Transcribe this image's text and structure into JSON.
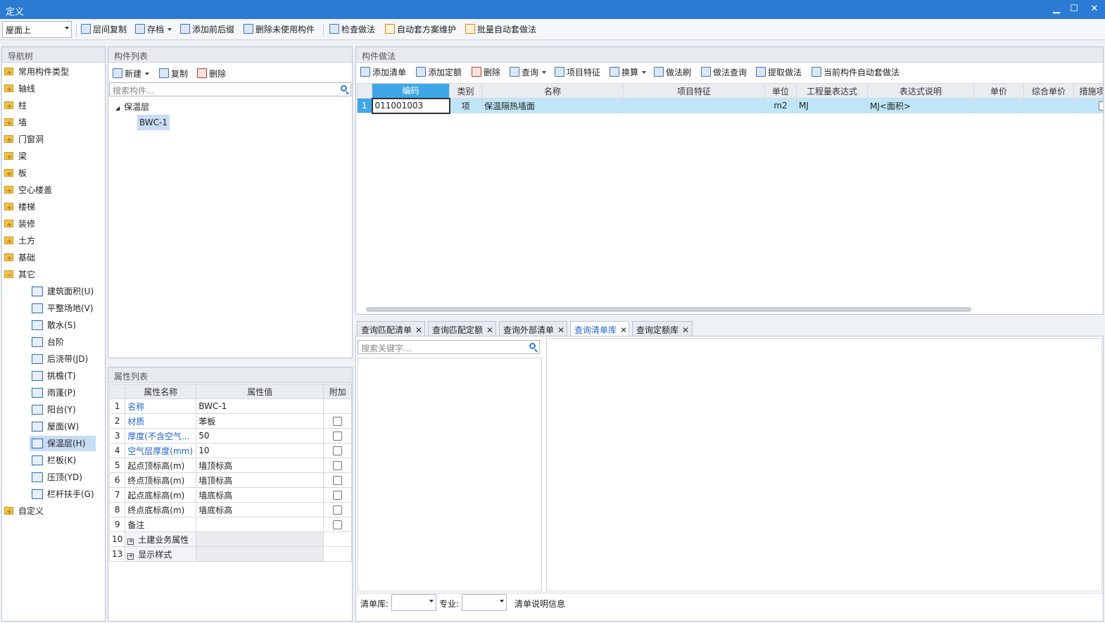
{
  "window": {
    "title": "定义",
    "min": "▁",
    "max": "☐",
    "close": "✕"
  },
  "toolbar": {
    "floor_value": "屋面上",
    "buttons": [
      "层间复制",
      "存档",
      "添加前后缀",
      "删除未使用构件",
      "检查做法",
      "自动套方案维护",
      "批量自动套做法"
    ]
  },
  "nav": {
    "title": "导航树",
    "top_items": [
      "常用构件类型",
      "轴线",
      "柱",
      "墙",
      "门窗洞",
      "梁",
      "板",
      "空心楼盖",
      "楼梯",
      "装修",
      "土方",
      "基础",
      "其它"
    ],
    "children": [
      "建筑面积(U)",
      "平整场地(V)",
      "散水(S)",
      "台阶",
      "后浇带(JD)",
      "挑檐(T)",
      "雨蓬(P)",
      "阳台(Y)",
      "屋面(W)",
      "保温层(H)",
      "栏板(K)",
      "压顶(YD)",
      "栏杆扶手(G)"
    ],
    "last_item": "自定义"
  },
  "component_list": {
    "title": "构件列表",
    "new_label": "新建",
    "copy_label": "复制",
    "delete_label": "删除",
    "search_placeholder": "搜索构件...",
    "group": "保温层",
    "selected_item": "BWC-1"
  },
  "properties": {
    "title": "属性列表",
    "headers": [
      "属性名称",
      "属性值",
      "附加"
    ],
    "rows": [
      {
        "n": "1",
        "name": "名称",
        "value": "BWC-1"
      },
      {
        "n": "2",
        "name": "材质",
        "value": "苯板"
      },
      {
        "n": "3",
        "name": "厚度(不含空气...",
        "value": "50"
      },
      {
        "n": "4",
        "name": "空气层厚度(mm)",
        "value": "10"
      },
      {
        "n": "5",
        "name": "起点顶标高(m)",
        "value": "墙顶标高"
      },
      {
        "n": "6",
        "name": "终点顶标高(m)",
        "value": "墙顶标高"
      },
      {
        "n": "7",
        "name": "起点底标高(m)",
        "value": "墙底标高"
      },
      {
        "n": "8",
        "name": "终点底标高(m)",
        "value": "墙底标高"
      },
      {
        "n": "9",
        "name": "备注",
        "value": ""
      }
    ],
    "groups": [
      {
        "n": "10",
        "name": "土建业务属性"
      },
      {
        "n": "13",
        "name": "显示样式"
      }
    ]
  },
  "method": {
    "title": "构件做法",
    "toolbar": [
      "添加清单",
      "添加定额",
      "删除",
      "查询",
      "项目特征",
      "换算",
      "做法刷",
      "做法查询",
      "提取做法",
      "当前构件自动套做法"
    ],
    "headers": [
      "编码",
      "类别",
      "名称",
      "项目特征",
      "单位",
      "工程量表达式",
      "表达式说明",
      "单价",
      "综合单价",
      "措施项"
    ],
    "row": {
      "n": "1",
      "code": "011001003",
      "type": "项",
      "name": "保温隔热墙面",
      "feature": "",
      "unit": "m2",
      "expr": "MJ",
      "expr_desc": "MJ<面积>",
      "price": "",
      "total": ""
    }
  },
  "query": {
    "tabs": [
      "查询匹配清单",
      "查询匹配定额",
      "查询外部清单",
      "查询清单库",
      "查询定额库"
    ],
    "active_tab": "查询清单库",
    "search_placeholder": "搜索关键字...",
    "bottom": {
      "lib_label": "清单库:",
      "major_label": "专业:",
      "info_label": "清单说明信息"
    }
  }
}
